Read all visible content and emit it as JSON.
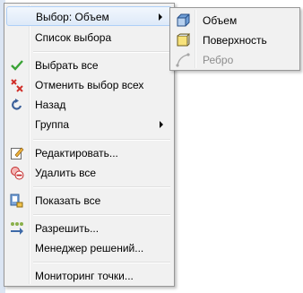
{
  "context_menu": {
    "items": [
      {
        "label": "Выбор: Объем",
        "icon": "none",
        "has_submenu": true
      },
      {
        "label": "Список выбора",
        "icon": "none",
        "has_submenu": false
      },
      {
        "label": "Выбрать все",
        "icon": "checkmark-icon",
        "has_submenu": false
      },
      {
        "label": "Отменить выбор всех",
        "icon": "deselect-icon",
        "has_submenu": false
      },
      {
        "label": "Назад",
        "icon": "back-arrow-icon",
        "has_submenu": false
      },
      {
        "label": "Группа",
        "icon": "none",
        "has_submenu": true
      },
      {
        "label": "Редактировать...",
        "icon": "edit-icon",
        "has_submenu": false
      },
      {
        "label": "Удалить все",
        "icon": "delete-icon",
        "has_submenu": false
      },
      {
        "label": "Показать все",
        "icon": "show-all-icon",
        "has_submenu": false
      },
      {
        "label": "Разрешить...",
        "icon": "resolve-icon",
        "has_submenu": false
      },
      {
        "label": "Менеджер решений...",
        "icon": "none",
        "has_submenu": false
      },
      {
        "label": "Мониторинг точки...",
        "icon": "none",
        "has_submenu": false
      }
    ]
  },
  "submenu": {
    "items": [
      {
        "label": "Объем",
        "icon": "volume-cube-icon",
        "enabled": true
      },
      {
        "label": "Поверхность",
        "icon": "surface-icon",
        "enabled": true
      },
      {
        "label": "Ребро",
        "icon": "edge-icon",
        "enabled": false
      }
    ]
  },
  "colors": {
    "highlight_border": "#aecff7",
    "menu_background": "#f1f1f1",
    "disabled_text": "#8d8d8d"
  }
}
